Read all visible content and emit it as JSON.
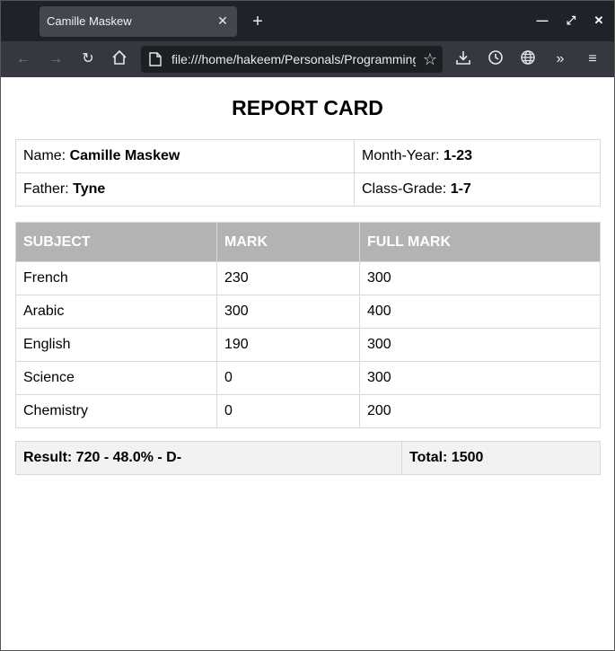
{
  "browser": {
    "tab_title": "Camille Maskew",
    "tab_close": "✕",
    "new_tab": "+",
    "url": "file:///home/hakeem/Personals/Programming",
    "window_controls": {
      "minimize": "—",
      "maximize": "⤢",
      "close": "✕"
    },
    "nav_icons": [
      "back-icon",
      "forward-icon",
      "reload-icon",
      "home-icon"
    ],
    "toolbar_icons": [
      "download-icon",
      "history-icon",
      "globe-icon",
      "more-tools-icon",
      "menu-icon"
    ]
  },
  "report": {
    "title": "REPORT CARD",
    "name_label": "Name:",
    "name": "Camille Maskew",
    "month_year_label": "Month-Year:",
    "month_year": "1-23",
    "father_label": "Father:",
    "father": "Tyne",
    "class_grade_label": "Class-Grade:",
    "class_grade": "1-7",
    "headers": [
      "SUBJECT",
      "MARK",
      "FULL MARK"
    ],
    "rows": [
      {
        "subject": "French",
        "mark": "230",
        "full": "300"
      },
      {
        "subject": "Arabic",
        "mark": "300",
        "full": "400"
      },
      {
        "subject": "English",
        "mark": "190",
        "full": "300"
      },
      {
        "subject": "Science",
        "mark": "0",
        "full": "300"
      },
      {
        "subject": "Chemistry",
        "mark": "0",
        "full": "200"
      }
    ],
    "result": "Result: 720 - 48.0% - D-",
    "total": "Total: 1500"
  }
}
